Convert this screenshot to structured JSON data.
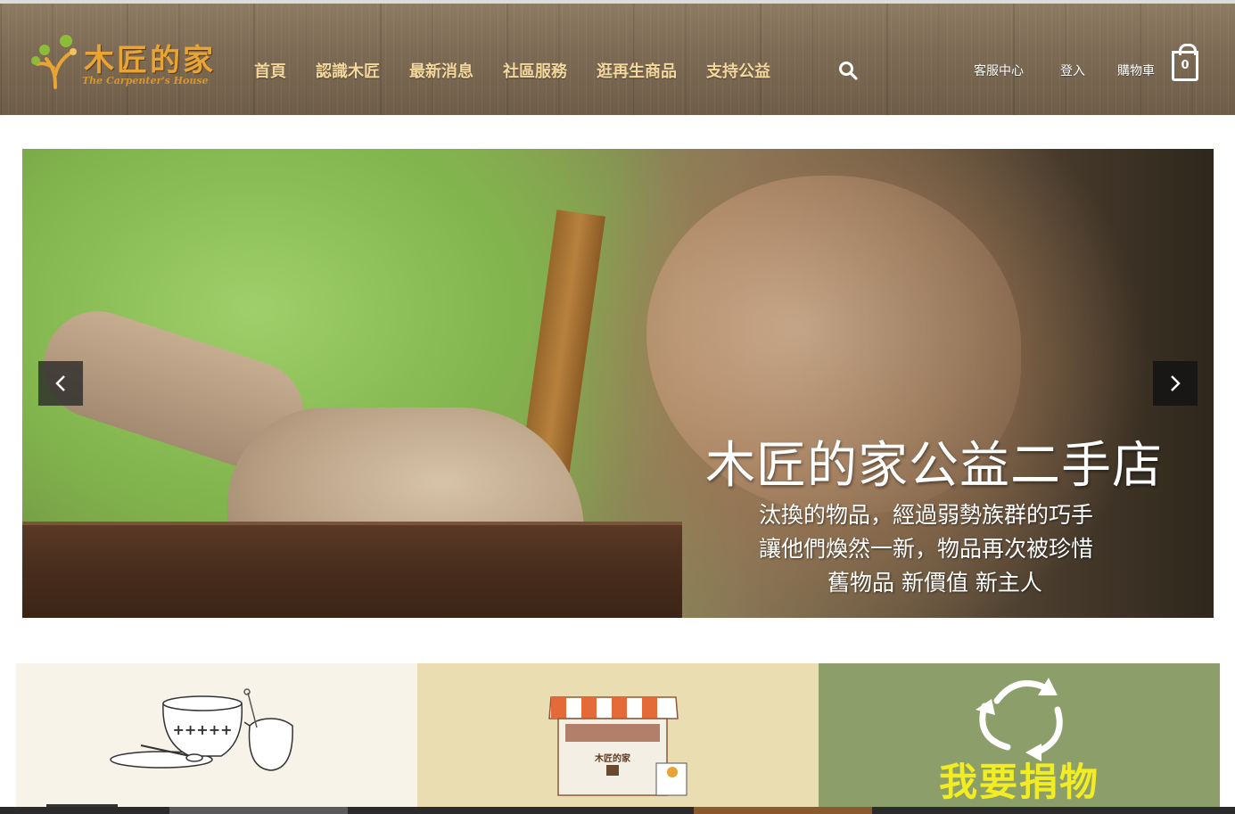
{
  "header": {
    "logo": {
      "name_cn": "木匠的家",
      "name_en": "The Carpenter's House"
    },
    "nav": [
      {
        "label": "首頁"
      },
      {
        "label": "認識木匠"
      },
      {
        "label": "最新消息"
      },
      {
        "label": "社區服務"
      },
      {
        "label": "逛再生商品"
      },
      {
        "label": "支持公益"
      }
    ],
    "search_icon": "search-icon",
    "utility": {
      "service_center": "客服中心",
      "login": "登入",
      "cart": "購物車",
      "cart_count": "0"
    }
  },
  "hero": {
    "title": "木匠的家公益二手店",
    "lines": [
      "汰換的物品，經過弱勢族群的巧手",
      "讓他們煥然一新，物品再次被珍惜",
      "舊物品 新價值 新主人"
    ],
    "prev_icon": "chevron-left-icon",
    "next_icon": "chevron-right-icon"
  },
  "tiles": [
    {
      "label": "",
      "icon": "teacup-illustration",
      "bg": "#f7f3e8"
    },
    {
      "label": "",
      "icon": "shop-illustration",
      "shop_sign": "木匠的家",
      "bg": "#e9ddb1"
    },
    {
      "label": "我要捐物",
      "icon": "recycle-icon",
      "bg": "#8c9f6a"
    }
  ],
  "colors": {
    "nav_text": "#f3d79c",
    "logo_orange": "#e8a434",
    "donate_text": "#f2ec22"
  }
}
